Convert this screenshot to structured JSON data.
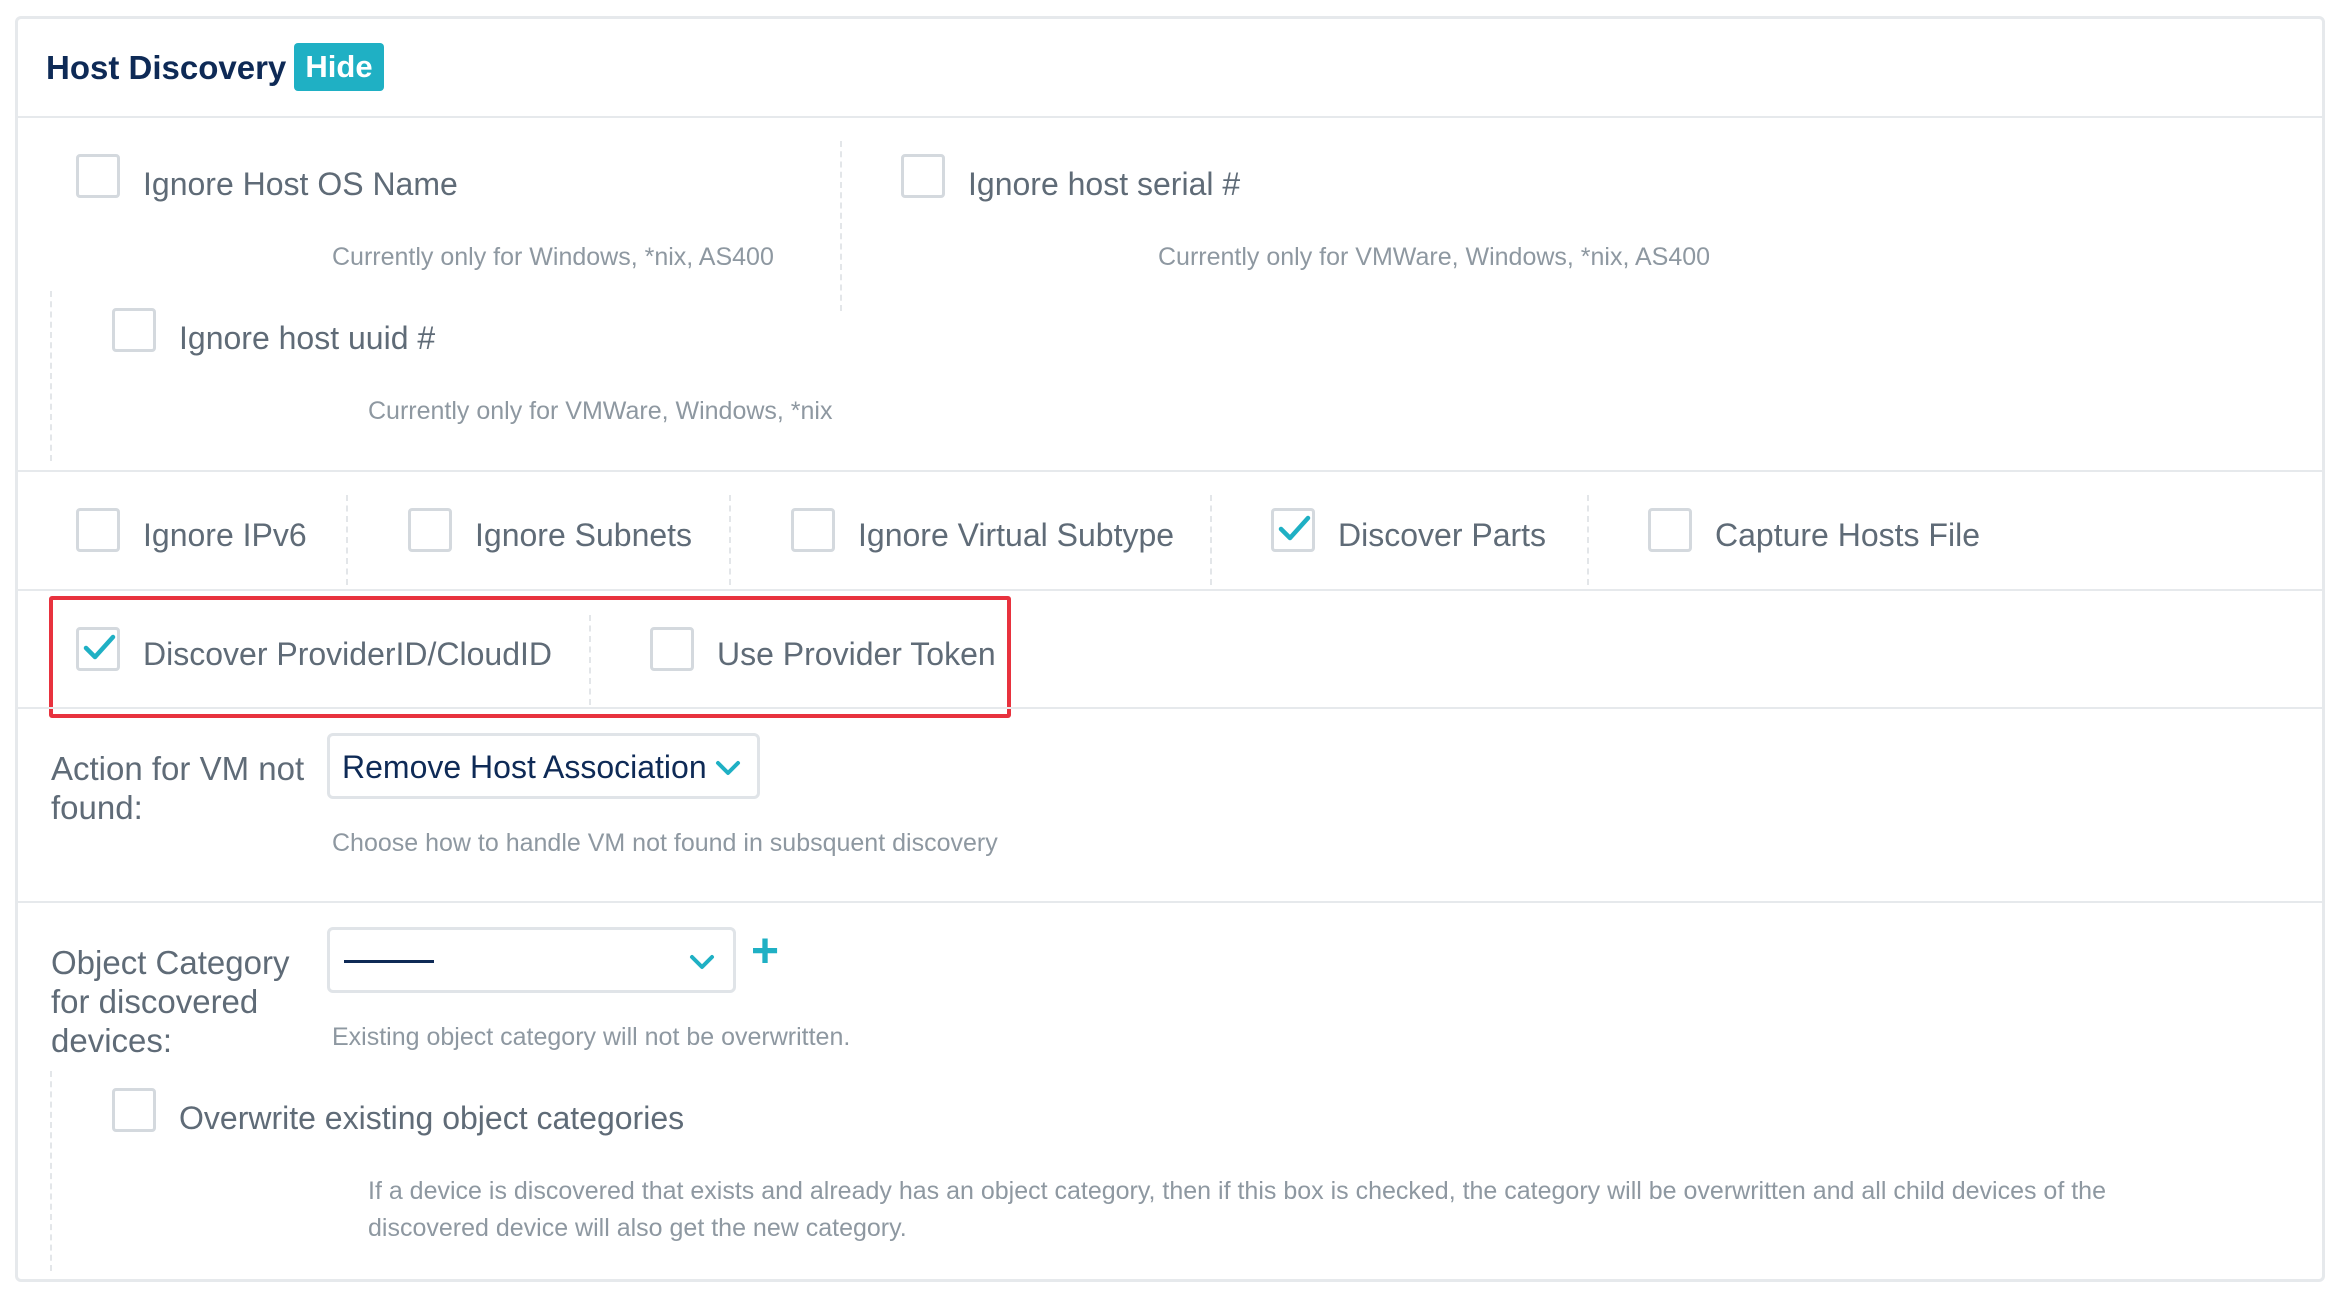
{
  "header": {
    "title": "Host Discovery",
    "hide_label": "Hide"
  },
  "accent_color": "#1fb0c4",
  "highlight_color": "#e8323e",
  "options_top": {
    "ignore_os": {
      "label": "Ignore Host OS Name",
      "hint": "Currently only for Windows, *nix, AS400",
      "checked": false
    },
    "ignore_serial": {
      "label": "Ignore host serial #",
      "hint": "Currently only for VMWare, Windows, *nix, AS400",
      "checked": false
    },
    "ignore_uuid": {
      "label": "Ignore host uuid #",
      "hint": "Currently only for VMWare, Windows, *nix",
      "checked": false
    }
  },
  "options_row": [
    {
      "label": "Ignore IPv6",
      "checked": false
    },
    {
      "label": "Ignore Subnets",
      "checked": false
    },
    {
      "label": "Ignore Virtual Subtype",
      "checked": false
    },
    {
      "label": "Discover Parts",
      "checked": true
    },
    {
      "label": "Capture Hosts File",
      "checked": false
    }
  ],
  "provider_row": [
    {
      "label": "Discover ProviderID/CloudID",
      "checked": true
    },
    {
      "label": "Use Provider Token",
      "checked": false
    }
  ],
  "vm_action": {
    "label": "Action for VM not found:",
    "selected": "Remove Host Association",
    "hint": "Choose how to handle VM not found in subsquent discovery"
  },
  "object_category": {
    "label": "Object Category for discovered devices:",
    "hint": "Existing object category will not be overwritten.",
    "add_label": "+",
    "overwrite": {
      "label": "Overwrite existing object categories",
      "checked": false,
      "hint_line1": "If a device is discovered that exists and already has an object category, then if this box is checked, the category will be overwritten and all child devices of the",
      "hint_line2": "discovered device will also get the new category."
    }
  }
}
